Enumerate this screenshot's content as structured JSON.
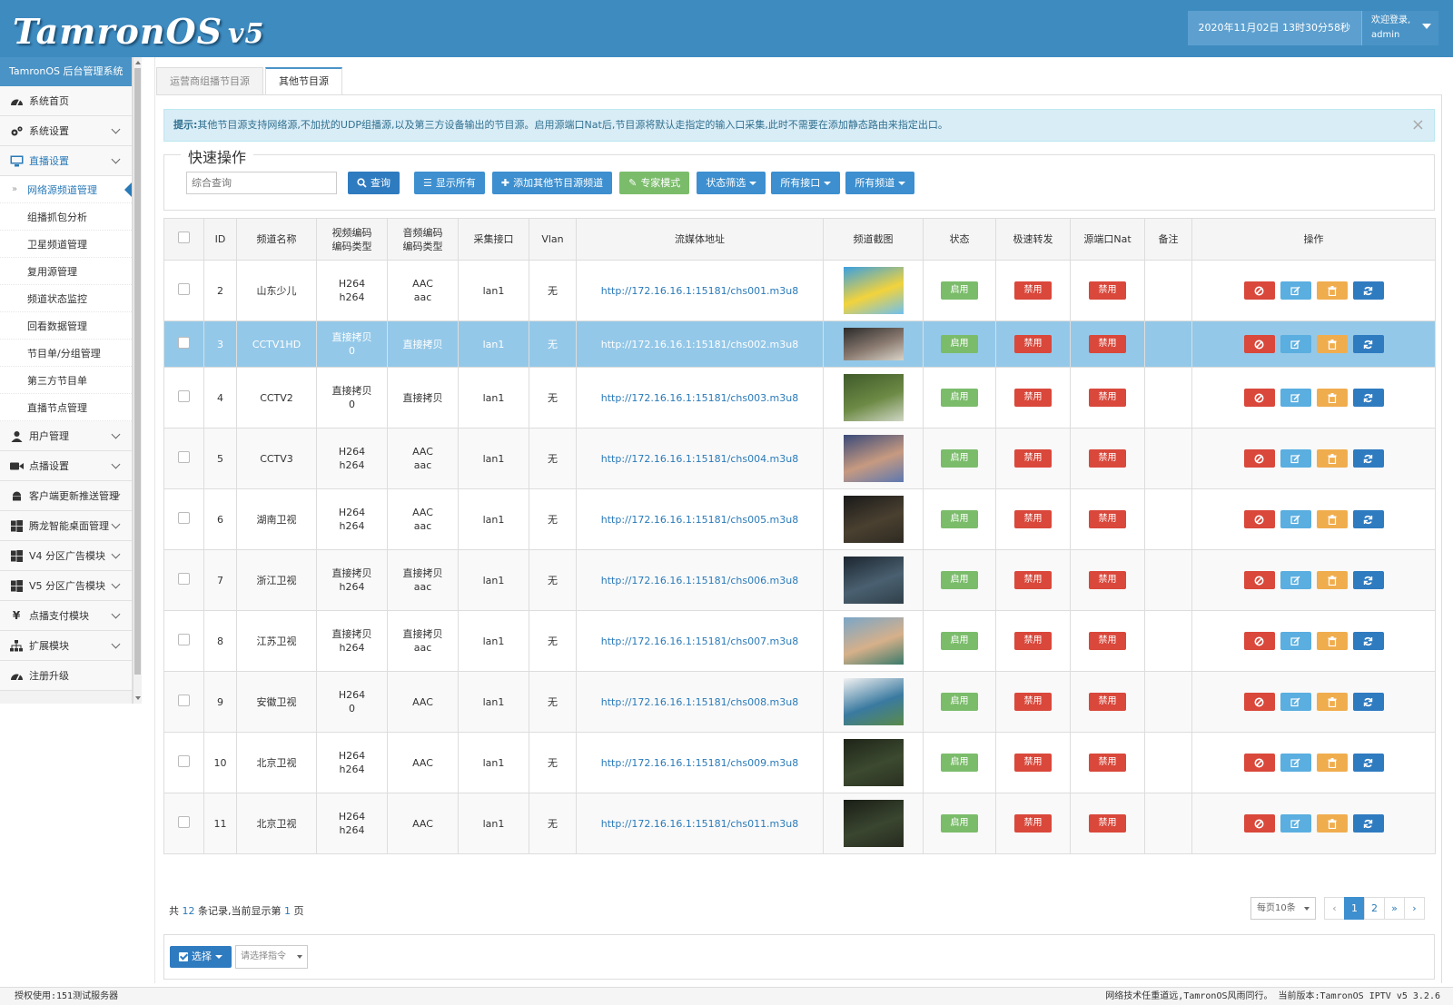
{
  "header": {
    "logo_main": "TamronOS",
    "logo_version": "v5",
    "datetime": "2020年11月02日 13时30分58秒",
    "welcome": "欢迎登录,",
    "username": "admin"
  },
  "sidebar": {
    "title": "TamronOS 后台管理系统",
    "items": [
      {
        "label": "系统首页",
        "icon": "dashboard-icon"
      },
      {
        "label": "系统设置",
        "icon": "gears-icon"
      },
      {
        "label": "直播设置",
        "icon": "monitor-icon"
      }
    ],
    "live_sub": [
      "网络源频道管理",
      "组播抓包分析",
      "卫星频道管理",
      "复用源管理",
      "频道状态监控",
      "回看数据管理",
      "节目单/分组管理",
      "第三方节目单",
      "直播节点管理"
    ],
    "items_after": [
      {
        "label": "用户管理",
        "icon": "user-icon"
      },
      {
        "label": "点播设置",
        "icon": "video-camera-icon"
      },
      {
        "label": "客户端更新推送管理",
        "icon": "android-icon"
      },
      {
        "label": "腾龙智能桌面管理",
        "icon": "windows-icon"
      },
      {
        "label": "V4 分区广告模块",
        "icon": "windows-icon"
      },
      {
        "label": "V5 分区广告模块",
        "icon": "windows-icon"
      },
      {
        "label": "点播支付模块",
        "icon": "yen-icon"
      },
      {
        "label": "扩展模块",
        "icon": "sitemap-icon"
      },
      {
        "label": "注册升级",
        "icon": "dashboard-icon"
      }
    ]
  },
  "tabs": [
    "运营商组播节目源",
    "其他节目源"
  ],
  "alert": {
    "prefix": "提示:",
    "text": "其他节目源支持网络源,不加扰的UDP组播源,以及第三方设备输出的节目源。启用源端口Nat后,节目源将默认走指定的输入口采集,此时不需要在添加静态路由来指定出口。",
    "close": "×"
  },
  "quick": {
    "legend": "快速操作",
    "search_placeholder": "综合查询",
    "query": "查询",
    "show_all": "显示所有",
    "add": "添加其他节目源频道",
    "expert": "专家模式",
    "status_filter": "状态筛选",
    "all_ports": "所有接口",
    "all_channels": "所有频道"
  },
  "table": {
    "headers": {
      "id": "ID",
      "name": "频道名称",
      "vcodec": "视频编码\n编码类型",
      "acodec": "音频编码\n编码类型",
      "port": "采集接口",
      "vlan": "Vlan",
      "url": "流媒体地址",
      "shot": "频道截图",
      "status": "状态",
      "fast": "极速转发",
      "nat": "源端口Nat",
      "note": "备注",
      "ops": "操作"
    },
    "enable_label": "启用",
    "disable_label": "禁用",
    "rows": [
      {
        "id": "2",
        "name": "山东少儿",
        "v1": "H264",
        "v2": "h264",
        "a1": "AAC",
        "a2": "aac",
        "port": "lan1",
        "vlan": "无",
        "url": "http://172.16.16.1:15181/chs001.m3u8",
        "thumb": [
          "#3aa0e0",
          "#f2d33c",
          "#6ec0ef"
        ]
      },
      {
        "id": "3",
        "name": "CCTV1HD",
        "v1": "直接拷贝",
        "v2": "0",
        "a1": "直接拷贝",
        "a2": "",
        "port": "lan1",
        "vlan": "无",
        "url": "http://172.16.16.1:15181/chs002.m3u8",
        "thumb": [
          "#2a2a2a",
          "#8a7a70",
          "#d9d3c7"
        ]
      },
      {
        "id": "4",
        "name": "CCTV2",
        "v1": "直接拷贝",
        "v2": "0",
        "a1": "直接拷贝",
        "a2": "",
        "port": "lan1",
        "vlan": "无",
        "url": "http://172.16.16.1:15181/chs003.m3u8",
        "thumb": [
          "#3f5a2a",
          "#6d8a45",
          "#cfd6c4"
        ]
      },
      {
        "id": "5",
        "name": "CCTV3",
        "v1": "H264",
        "v2": "h264",
        "a1": "AAC",
        "a2": "aac",
        "port": "lan1",
        "vlan": "无",
        "url": "http://172.16.16.1:15181/chs004.m3u8",
        "thumb": [
          "#3a4a7a",
          "#c79a80",
          "#5d78b0"
        ]
      },
      {
        "id": "6",
        "name": "湖南卫视",
        "v1": "H264",
        "v2": "h264",
        "a1": "AAC",
        "a2": "aac",
        "port": "lan1",
        "vlan": "无",
        "url": "http://172.16.16.1:15181/chs005.m3u8",
        "thumb": [
          "#1a1a1a",
          "#4a4030",
          "#2e2a22"
        ]
      },
      {
        "id": "7",
        "name": "浙江卫视",
        "v1": "直接拷贝",
        "v2": "h264",
        "a1": "直接拷贝",
        "a2": "aac",
        "port": "lan1",
        "vlan": "无",
        "url": "http://172.16.16.1:15181/chs006.m3u8",
        "thumb": [
          "#1c2630",
          "#4a6070",
          "#30404a"
        ]
      },
      {
        "id": "8",
        "name": "江苏卫视",
        "v1": "直接拷贝",
        "v2": "h264",
        "a1": "直接拷贝",
        "a2": "aac",
        "port": "lan1",
        "vlan": "无",
        "url": "http://172.16.16.1:15181/chs007.m3u8",
        "thumb": [
          "#7aa6c8",
          "#d6b08a",
          "#3a7a6a"
        ]
      },
      {
        "id": "9",
        "name": "安徽卫视",
        "v1": "H264",
        "v2": "0",
        "a1": "AAC",
        "a2": "",
        "port": "lan1",
        "vlan": "无",
        "url": "http://172.16.16.1:15181/chs008.m3u8",
        "thumb": [
          "#f2f2f2",
          "#3a7aa0",
          "#5a8a4a"
        ]
      },
      {
        "id": "10",
        "name": "北京卫视",
        "v1": "H264",
        "v2": "h264",
        "a1": "AAC",
        "a2": "",
        "port": "lan1",
        "vlan": "无",
        "url": "http://172.16.16.1:15181/chs009.m3u8",
        "thumb": [
          "#1e2418",
          "#3c4a30",
          "#2a3020"
        ]
      },
      {
        "id": "11",
        "name": "北京卫视",
        "v1": "H264",
        "v2": "h264",
        "a1": "AAC",
        "a2": "",
        "port": "lan1",
        "vlan": "无",
        "url": "http://172.16.16.1:15181/chs011.m3u8",
        "thumb": [
          "#1a1e16",
          "#3a4630",
          "#262a1e"
        ]
      }
    ]
  },
  "footer": {
    "total_prefix": "共",
    "total": "12",
    "total_mid": "条记录,当前显示第",
    "page": "1",
    "total_suffix": "页",
    "per_page": "每页10条",
    "pages": [
      "‹",
      "1",
      "2",
      "»",
      "›"
    ]
  },
  "bottom": {
    "select_label": "选择",
    "command_placeholder": "请选择指令"
  },
  "statusbar": {
    "license": "授权使用:151测试服务器",
    "right": "网络技术任重道远,TamronOS风雨同行。 当前版本:TamronOS IPTV v5 3.2.6"
  },
  "colors": {
    "header_bg": "#3e8bc0",
    "primary": "#2f7bc0",
    "enable_green": "#7bbc6b",
    "disable_red": "#d9483b",
    "selected_row": "#94c8e8"
  }
}
